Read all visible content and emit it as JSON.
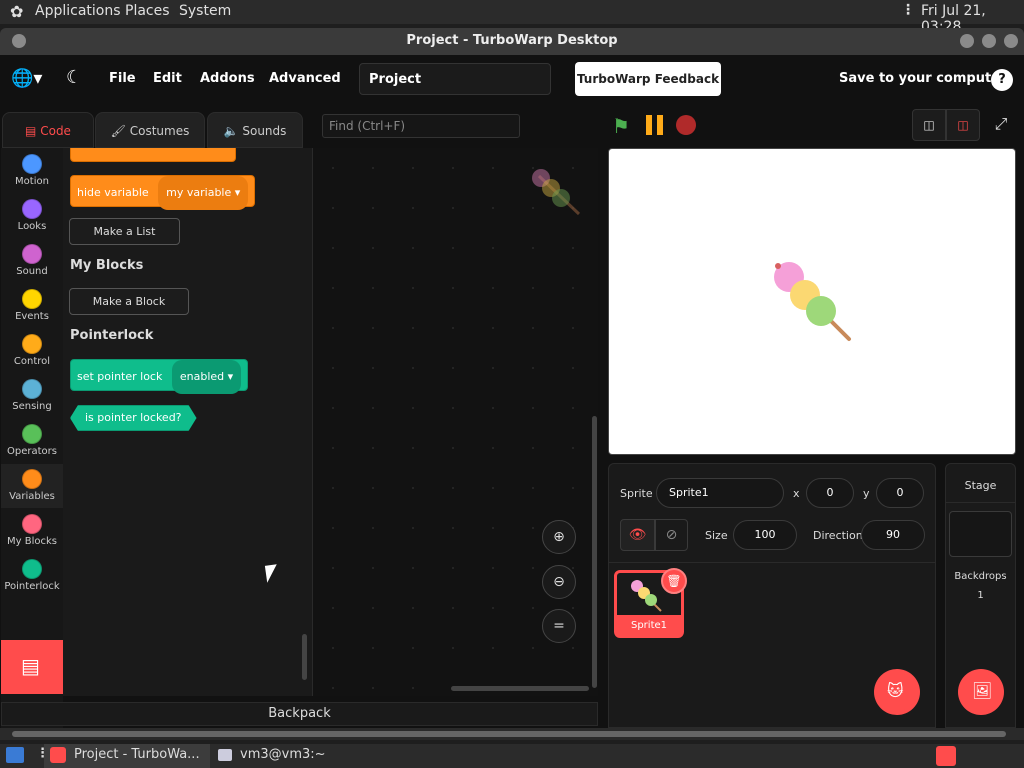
{
  "top_panel": {
    "menus": [
      "Applications",
      "Places",
      "System"
    ],
    "clock": "Fri Jul 21, 03:28"
  },
  "window": {
    "title": "Project - TurboWarp Desktop"
  },
  "menubar": {
    "items": [
      "File",
      "Edit",
      "Addons",
      "Advanced"
    ],
    "project_title": "Project",
    "feedback": "TurboWarp Feedback",
    "save": "Save to your computer",
    "help": "?"
  },
  "tabs": [
    {
      "label": "Code",
      "active": true
    },
    {
      "label": "Costumes",
      "active": false
    },
    {
      "label": "Sounds",
      "active": false
    }
  ],
  "search": {
    "placeholder": "Find (Ctrl+F)"
  },
  "categories": [
    {
      "label": "Motion",
      "color": "#4c97ff"
    },
    {
      "label": "Looks",
      "color": "#9966ff"
    },
    {
      "label": "Sound",
      "color": "#cf63cf"
    },
    {
      "label": "Events",
      "color": "#ffd500"
    },
    {
      "label": "Control",
      "color": "#ffab19"
    },
    {
      "label": "Sensing",
      "color": "#5cb1d6"
    },
    {
      "label": "Operators",
      "color": "#59c059"
    },
    {
      "label": "Variables",
      "color": "#ff8c1a"
    },
    {
      "label": "My Blocks",
      "color": "#ff6680"
    },
    {
      "label": "Pointerlock",
      "color": "#0fbd8c"
    }
  ],
  "flyout": {
    "hide_variable": "hide variable",
    "variable_name": "my variable",
    "make_list": "Make a List",
    "my_blocks_heading": "My Blocks",
    "make_block": "Make a Block",
    "pointerlock_heading": "Pointerlock",
    "set_pointer_lock": "set pointer lock",
    "pointer_lock_value": "enabled",
    "is_pointer_locked": "is pointer locked?"
  },
  "backpack": "Backpack",
  "sprite_info": {
    "sprite_label": "Sprite",
    "sprite_name": "Sprite1",
    "x_label": "x",
    "x_value": "0",
    "y_label": "y",
    "y_value": "0",
    "size_label": "Size",
    "size_value": "100",
    "direction_label": "Direction",
    "direction_value": "90"
  },
  "sprites": [
    {
      "name": "Sprite1",
      "selected": true
    }
  ],
  "stage_panel": {
    "title": "Stage",
    "backdrops_label": "Backdrops",
    "backdrops_count": "1"
  },
  "taskbar": {
    "items": [
      "Project - TurboWa...",
      "vm3@vm3:~"
    ]
  },
  "colors": {
    "accent": "#ff4c4c",
    "variables": "#ff8c1a",
    "pointerlock": "#0fbd8c"
  }
}
